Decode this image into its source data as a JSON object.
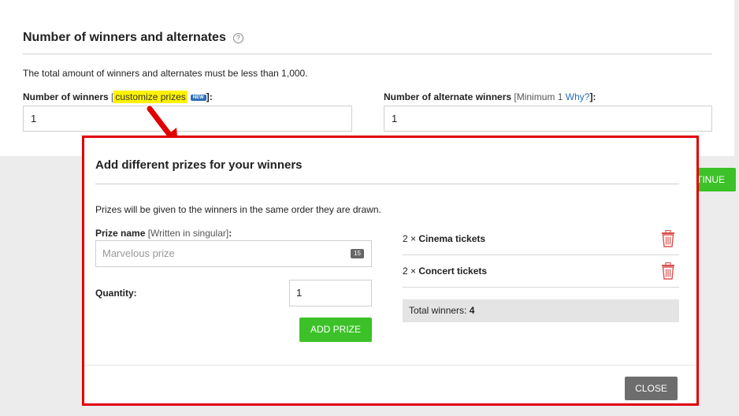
{
  "background": {
    "section_title": "Number of winners and alternates",
    "help_icon": "?",
    "description": "The total amount of winners and alternates must be less than 1,000.",
    "winners_label": "Number of winners",
    "winners_bracket_open": "[",
    "customize_link": "customize prizes",
    "new_badge": "NEW",
    "winners_bracket_close": "]:",
    "winners_value": "1",
    "alternates_label": "Number of alternate winners",
    "alternates_hint": "[Minimum 1",
    "why_link": "Why?",
    "alternates_hint_close": "]:",
    "alternates_value": "1",
    "continue_label": "TINUE"
  },
  "modal": {
    "title": "Add different prizes for your winners",
    "description": "Prizes will be given to the winners in the same order they are drawn.",
    "prize_name_label": "Prize name",
    "prize_name_hint": "[Written in singular]",
    "prize_name_colon": ":",
    "prize_name_placeholder": "Marvelous prize",
    "char_count": "15",
    "quantity_label": "Quantity:",
    "quantity_value": "1",
    "add_prize_label": "ADD PRIZE",
    "prizes": [
      {
        "qty": "2 ×",
        "name": "Cinema tickets"
      },
      {
        "qty": "2 ×",
        "name": "Concert tickets"
      }
    ],
    "total_label": "Total winners:",
    "total_value": "4",
    "close_label": "CLOSE"
  },
  "colors": {
    "accent_green": "#3cc228",
    "highlight_red": "#e00000",
    "link_blue": "#2a6ebb",
    "trash_red": "#d9534f"
  },
  "icons": [
    "help-icon",
    "trash-icon",
    "red-arrow-annotation"
  ]
}
